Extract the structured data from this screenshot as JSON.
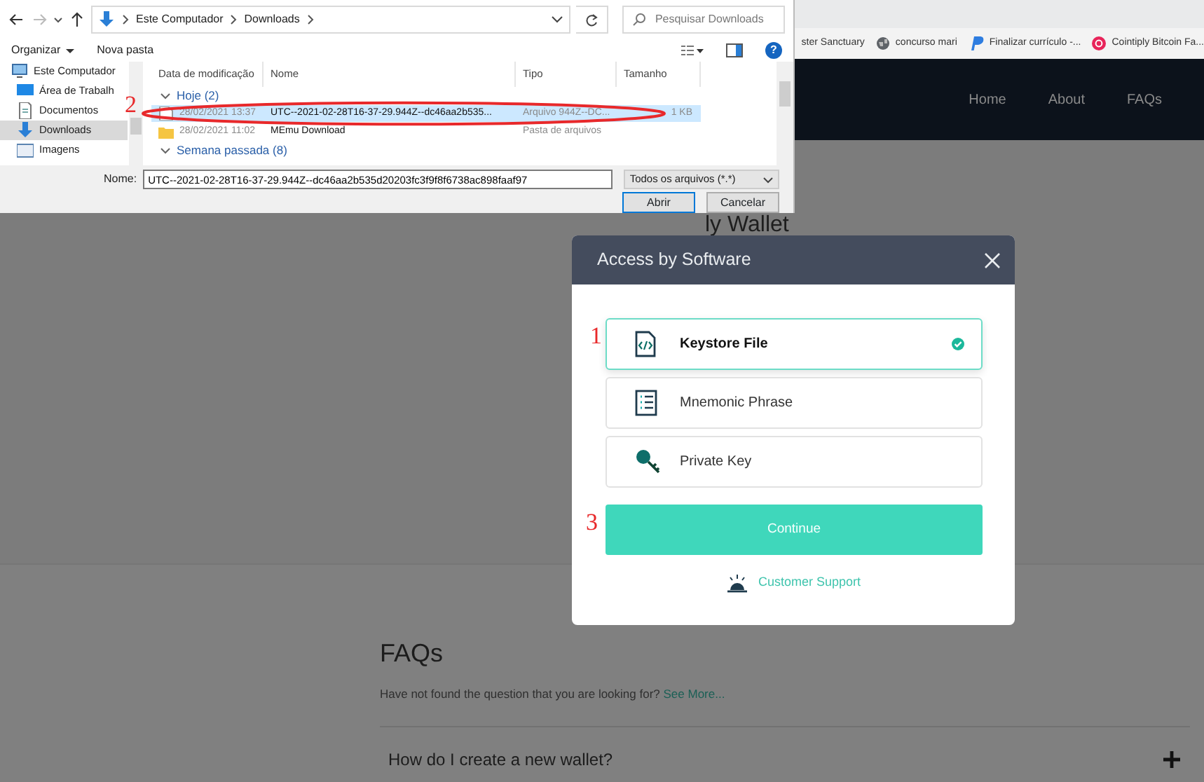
{
  "browser": {
    "bookmarks": [
      {
        "label": "ster Sanctuary",
        "kind": "none"
      },
      {
        "label": "concurso mari",
        "kind": "globe"
      },
      {
        "label": "Finalizar currículo -...",
        "kind": "letter"
      },
      {
        "label": "Cointiply Bitcoin Fa...",
        "kind": "coin"
      }
    ]
  },
  "site": {
    "nav": [
      {
        "label": "Home"
      },
      {
        "label": "About"
      },
      {
        "label": "FAQs"
      }
    ],
    "hero_title": "ly Wallet",
    "faqs": {
      "title": "FAQs",
      "subtitle": "Have not found the question that you are looking for?",
      "link": "See More...",
      "items": [
        {
          "question": "How do I create a new wallet?",
          "expanded": false
        }
      ]
    }
  },
  "file_dialog": {
    "path": [
      "Este Computador",
      "Downloads"
    ],
    "search_placeholder": "Pesquisar Downloads",
    "toolbar": [
      "Organizar",
      "Nova pasta"
    ],
    "help": "?",
    "sidebar": [
      {
        "label": "Este Computador",
        "kind": "computer",
        "selected": false,
        "children": [
          {
            "label": "Área de Trabalh",
            "kind": "desktop",
            "selected": false
          },
          {
            "label": "Documentos",
            "kind": "document",
            "selected": false
          },
          {
            "label": "Downloads",
            "kind": "download",
            "selected": true
          },
          {
            "label": "Imagens",
            "kind": "image",
            "selected": false
          }
        ]
      }
    ],
    "columns": [
      "Data de modificação",
      "Nome",
      "Tipo",
      "Tamanho"
    ],
    "groups": [
      {
        "label": "Hoje (2)",
        "expanded": true,
        "rows": [
          {
            "date": "28/02/2021 13:37",
            "name": "UTC--2021-02-28T16-37-29.944Z--dc46aa2b535...",
            "type": "Arquivo 944Z--DC...",
            "size": "1 KB",
            "kind": "file",
            "selected": true
          },
          {
            "date": "28/02/2021 11:02",
            "name": "MEmu Download",
            "type": "Pasta de arquivos",
            "kind": "folder",
            "selected": false
          }
        ]
      },
      {
        "label": "Semana passada (8)",
        "expanded": true
      }
    ],
    "filename_label": "Nome:",
    "filename": "UTC--2021-02-28T16-37-29.944Z--dc46aa2b535d20203fc3f9f8f6738ac898faaf97",
    "filter": "Todos os arquivos (*.*)",
    "buttons": [
      "Abrir",
      "Cancelar"
    ]
  },
  "modal": {
    "title": "Access by Software",
    "options": [
      {
        "label": "Keystore File",
        "kind": "file",
        "selected": true
      },
      {
        "label": "Mnemonic Phrase",
        "kind": "list",
        "selected": false
      },
      {
        "label": "Private Key",
        "kind": "key",
        "selected": false
      }
    ],
    "continue": "Continue",
    "support": "Customer Support"
  },
  "annotations": [
    {
      "text": "1"
    },
    {
      "text": "2"
    },
    {
      "text": "3"
    }
  ]
}
